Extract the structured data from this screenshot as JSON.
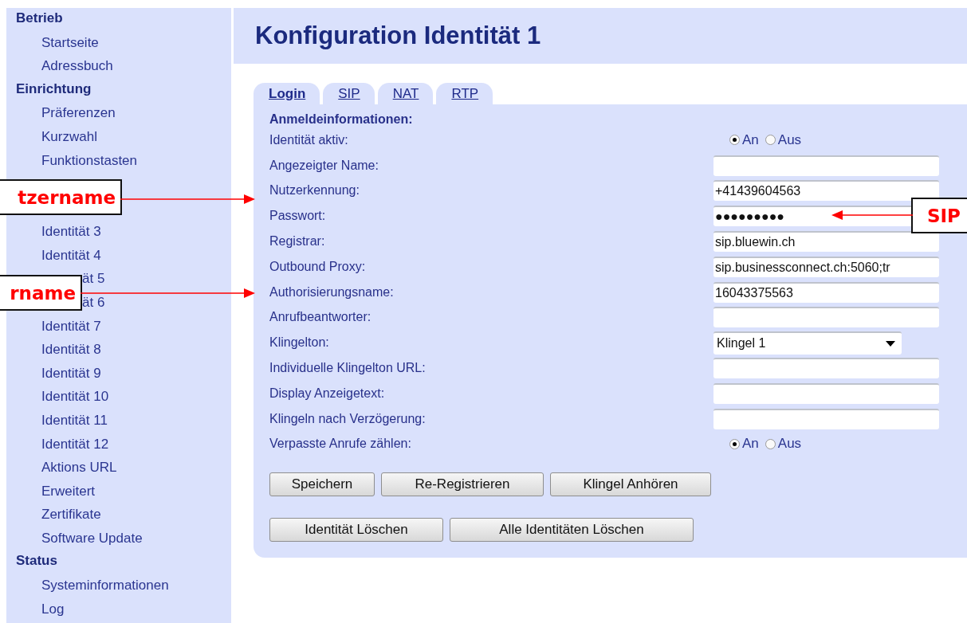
{
  "sidebar": {
    "sections": [
      {
        "title": "Betrieb",
        "items": [
          {
            "label": "Startseite",
            "kind": "link"
          },
          {
            "label": "Adressbuch",
            "kind": "link"
          }
        ]
      },
      {
        "title": "Einrichtung",
        "items": [
          {
            "label": "Präferenzen",
            "kind": "link"
          },
          {
            "label": "Kurzwahl",
            "kind": "link"
          },
          {
            "label": "Funktionstasten",
            "kind": "link"
          },
          {
            "label": "Identität 3",
            "kind": "link"
          },
          {
            "label": "Identität 4",
            "kind": "link"
          },
          {
            "label": "ät 5",
            "kind": "covered"
          },
          {
            "label": "ät 6",
            "kind": "covered"
          },
          {
            "label": "Identität 7",
            "kind": "link"
          },
          {
            "label": "Identität 8",
            "kind": "link"
          },
          {
            "label": "Identität 9",
            "kind": "link"
          },
          {
            "label": "Identität 10",
            "kind": "link"
          },
          {
            "label": "Identität 11",
            "kind": "link"
          },
          {
            "label": "Identität 12",
            "kind": "link"
          },
          {
            "label": "Aktions URL",
            "kind": "link"
          },
          {
            "label": "Erweitert",
            "kind": "link"
          },
          {
            "label": "Zertifikate",
            "kind": "link"
          },
          {
            "label": "Software Update",
            "kind": "link"
          }
        ]
      },
      {
        "title": "Status",
        "items": [
          {
            "label": "Systeminformationen",
            "kind": "link"
          },
          {
            "label": "Log",
            "kind": "link"
          }
        ]
      }
    ]
  },
  "page_title": "Konfiguration Identität 1",
  "tabs": [
    {
      "label": "Login",
      "selected": true
    },
    {
      "label": "SIP",
      "selected": false
    },
    {
      "label": "NAT",
      "selected": false
    },
    {
      "label": "RTP",
      "selected": false
    }
  ],
  "form": {
    "heading": "Anmeldeinformationen:",
    "rows": [
      {
        "label": "Identität aktiv:",
        "kind": "radio",
        "options": [
          {
            "label": "An",
            "selected": true
          },
          {
            "label": "Aus",
            "selected": false
          }
        ]
      },
      {
        "label": "Angezeigter Name:",
        "kind": "text"
      },
      {
        "label": "Nutzerkennung:",
        "kind": "text",
        "value": "+41439604563"
      },
      {
        "label": "Passwort:",
        "kind": "text",
        "value": "●●●●●●●●●"
      },
      {
        "label": "Registrar:",
        "kind": "text",
        "value": "sip.bluewin.ch"
      },
      {
        "label": "Outbound Proxy:",
        "kind": "text",
        "value": "sip.businessconnect.ch:5060;tr"
      },
      {
        "label": "Authorisierungsname:",
        "kind": "text",
        "value": "16043375563"
      },
      {
        "label": "Anrufbeantworter:",
        "kind": "text"
      },
      {
        "label": "Klingelton:",
        "kind": "select",
        "value": "Klingel 1"
      },
      {
        "label": "Individuelle Klingelton URL:",
        "kind": "text"
      },
      {
        "label": "Display Anzeigetext:",
        "kind": "text"
      },
      {
        "label": "Klingeln nach Verzögerung:",
        "kind": "text"
      },
      {
        "label": "Verpasste Anrufe zählen:",
        "kind": "radio",
        "options": [
          {
            "label": "An",
            "selected": true
          },
          {
            "label": "Aus",
            "selected": false
          }
        ]
      }
    ]
  },
  "button_rows": [
    [
      "Speichern",
      "Re-Registrieren",
      "Klingel Anhören"
    ],
    [
      "Identität Löschen",
      "Alle Identitäten Löschen"
    ]
  ],
  "annotations": [
    {
      "text": "tzername"
    },
    {
      "text": "rname"
    },
    {
      "text": "SIP"
    }
  ]
}
